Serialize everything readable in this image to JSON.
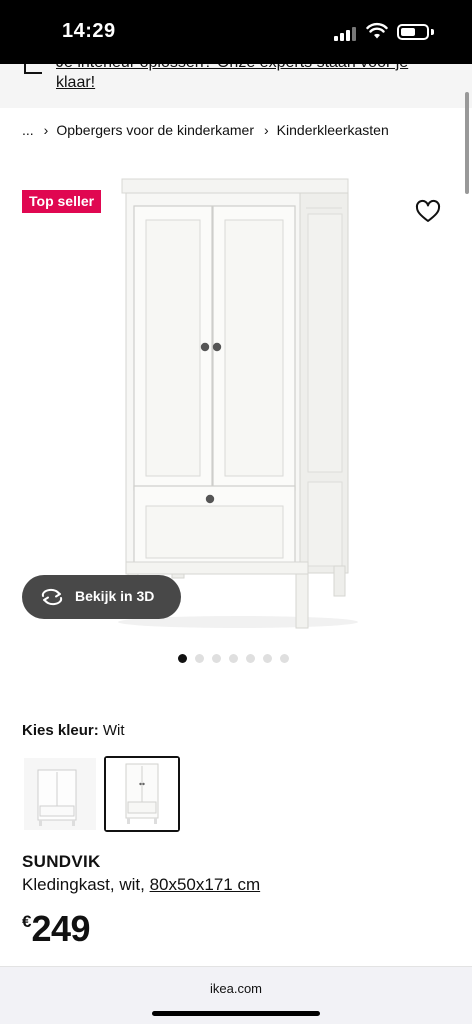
{
  "status_bar": {
    "time": "14:29"
  },
  "banner": {
    "line1": "Je interieur oplossen? Onze experts staan voor je",
    "line2": "klaar!"
  },
  "breadcrumb": {
    "ellipsis": "...",
    "separator": "›",
    "items": [
      "Opbergers voor de kinderkamer",
      "Kinderkleerkasten"
    ]
  },
  "product": {
    "badge": "Top seller",
    "view_3d_label": "Bekijk in 3D",
    "gallery": {
      "count": 7,
      "active_index": 0
    },
    "color_prompt": "Kies kleur:",
    "color_value": "Wit",
    "name": "SUNDVIK",
    "description": "Kledingkast, wit, ",
    "dimensions": "80x50x171 cm",
    "currency": "€",
    "price": "249"
  },
  "browser": {
    "url": "ikea.com"
  },
  "colors": {
    "badge_bg": "#e00751",
    "button_3d_bg": "#484848",
    "text": "#111111"
  },
  "icons": {
    "favorite": "heart-outline-icon",
    "rotate": "rotate-3d-icon",
    "signal": "cellular-signal-icon",
    "wifi": "wifi-icon",
    "battery": "battery-icon"
  }
}
